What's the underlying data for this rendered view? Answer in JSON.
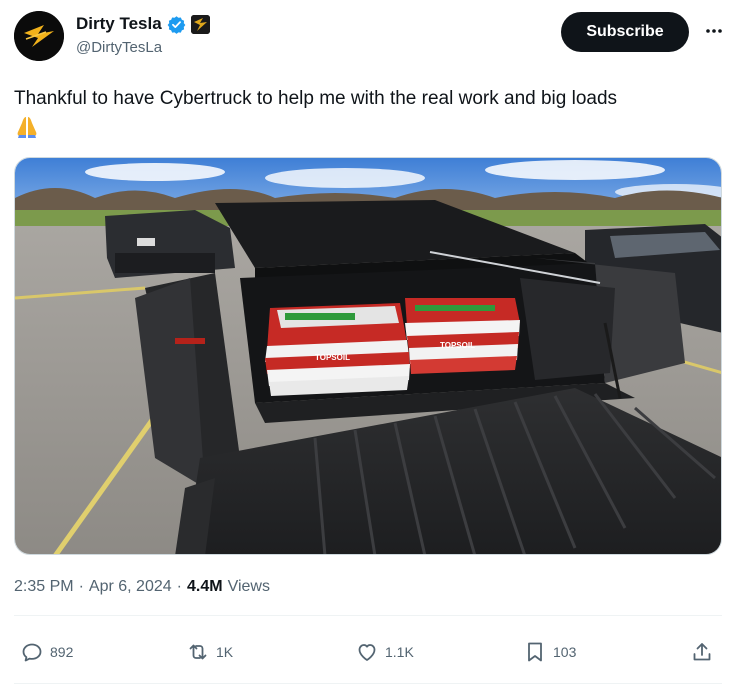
{
  "author": {
    "display_name": "Dirty Tesla",
    "handle": "@DirtyTesLa",
    "verified": true
  },
  "header": {
    "subscribe_label": "Subscribe"
  },
  "tweet": {
    "text": "Thankful to have Cybertruck to help me with the real work and big loads",
    "emoji": "🙏"
  },
  "media": {
    "bag_brand": "TOPSOIL"
  },
  "meta": {
    "time": "2:35 PM",
    "date": "Apr 6, 2024",
    "separator": "·",
    "views_count": "4.4M",
    "views_label": "Views"
  },
  "actions": {
    "replies": "892",
    "reposts": "1K",
    "likes": "1.1K",
    "bookmarks": "103"
  },
  "colors": {
    "text": "#0f1419",
    "secondary": "#536471",
    "verified": "#1d9bf0",
    "divider": "#eff3f4"
  }
}
